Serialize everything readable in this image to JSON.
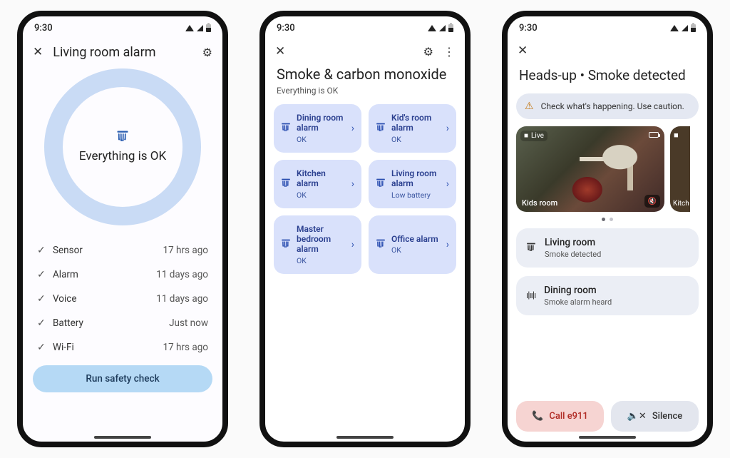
{
  "status_time": "9:30",
  "screen1": {
    "title": "Living room alarm",
    "ring_text": "Everything is OK",
    "checks": [
      {
        "label": "Sensor",
        "time": "17 hrs ago"
      },
      {
        "label": "Alarm",
        "time": "11 days ago"
      },
      {
        "label": "Voice",
        "time": "11 days ago"
      },
      {
        "label": "Battery",
        "time": "Just now"
      },
      {
        "label": "Wi-Fi",
        "time": "17 hrs ago"
      }
    ],
    "button": "Run safety check"
  },
  "screen2": {
    "title": "Smoke & carbon monoxide",
    "subtitle": "Everything is OK",
    "tiles": [
      {
        "name": "Dining room alarm",
        "status": "OK"
      },
      {
        "name": "Kid's room alarm",
        "status": "OK"
      },
      {
        "name": "Kitchen alarm",
        "status": "OK"
      },
      {
        "name": "Living room alarm",
        "status": "Low battery"
      },
      {
        "name": "Master bedroom alarm",
        "status": "OK"
      },
      {
        "name": "Office alarm",
        "status": "OK"
      }
    ]
  },
  "screen3": {
    "title": "Heads-up • Smoke detected",
    "warning": "Check what's happening. Use caution.",
    "camera_main": {
      "badge": "Live",
      "name": "Kids room"
    },
    "camera_side_name": "Kitch",
    "alerts": [
      {
        "icon": "nest",
        "name": "Living room",
        "status": "Smoke detected"
      },
      {
        "icon": "sound",
        "name": "Dining room",
        "status": "Smoke alarm heard"
      }
    ],
    "call_label": "Call e911",
    "silence_label": "Silence"
  }
}
